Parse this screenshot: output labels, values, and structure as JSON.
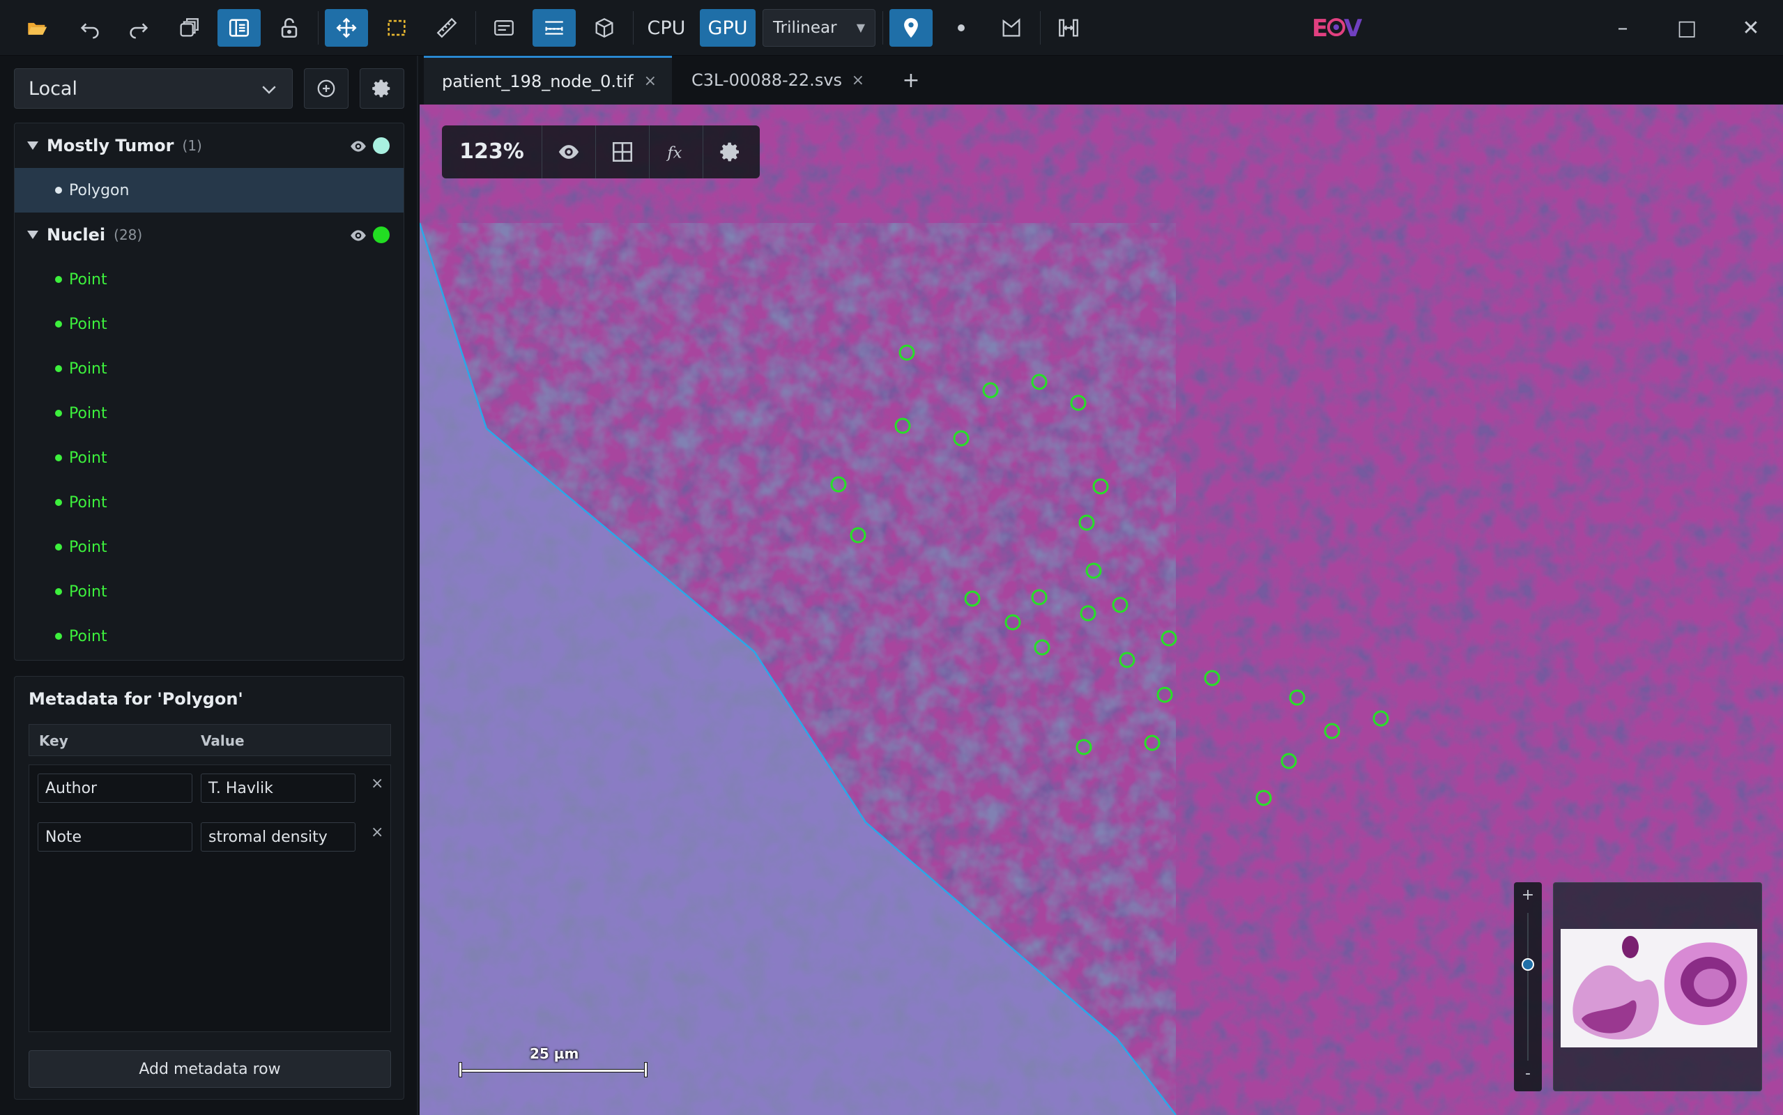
{
  "toolbar": {
    "cpu_label": "CPU",
    "gpu_label": "GPU",
    "interpolation": "Trilinear",
    "logo_text": "EOV",
    "icons": [
      "folder-open-icon",
      "undo-icon",
      "redo-icon",
      "layers-icon",
      "panel-layout-icon",
      "unlock-icon",
      "move-icon",
      "rect-select-icon",
      "ruler-icon",
      "annotation-panel-icon",
      "scale-icon",
      "cube-icon",
      "map-pin-icon",
      "point-icon",
      "polygon-icon",
      "fit-width-icon"
    ],
    "active": [
      "panel-layout-icon",
      "move-icon",
      "scale-icon",
      "gpu",
      "map-pin-icon"
    ]
  },
  "window": {
    "minimize": "–",
    "maximize": "□",
    "close": "✕"
  },
  "sidebar": {
    "source": "Local",
    "groups": [
      {
        "name": "Mostly Tumor",
        "count": "(1)",
        "color": "#a8f0e0",
        "items": [
          {
            "label": "Polygon",
            "color": "#dfe8ee",
            "selected": true
          }
        ]
      },
      {
        "name": "Nuclei",
        "count": "(28)",
        "color": "#22dd22",
        "items": [
          {
            "label": "Point",
            "color": "#3df03d"
          },
          {
            "label": "Point",
            "color": "#3df03d"
          },
          {
            "label": "Point",
            "color": "#3df03d"
          },
          {
            "label": "Point",
            "color": "#3df03d"
          },
          {
            "label": "Point",
            "color": "#3df03d"
          },
          {
            "label": "Point",
            "color": "#3df03d"
          },
          {
            "label": "Point",
            "color": "#3df03d"
          },
          {
            "label": "Point",
            "color": "#3df03d"
          },
          {
            "label": "Point",
            "color": "#3df03d"
          }
        ]
      }
    ]
  },
  "metadata": {
    "title": "Metadata for 'Polygon'",
    "key_header": "Key",
    "value_header": "Value",
    "rows": [
      {
        "key": "Author",
        "value": "T. Havlik"
      },
      {
        "key": "Note",
        "value": "stromal density"
      }
    ],
    "remove_symbol": "×",
    "add_row_label": "Add metadata row"
  },
  "tabs": [
    {
      "label": "patient_198_node_0.tif",
      "active": true
    },
    {
      "label": "C3L-00088-22.svs",
      "active": false
    }
  ],
  "tab_close": "×",
  "tab_add": "+",
  "viewer": {
    "zoom": "123%",
    "scale_label": "25 µm",
    "zoom_plus": "+",
    "zoom_minus": "-",
    "zoom_level": 0.65,
    "annotation_color": "#28e028",
    "polygon_color": "#2aa8e8"
  }
}
